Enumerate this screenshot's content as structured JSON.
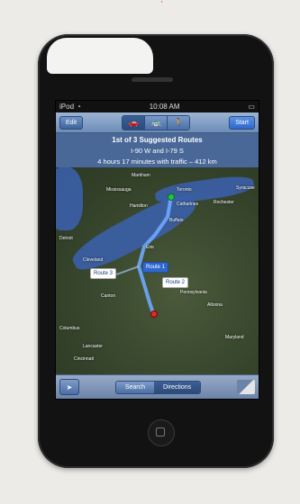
{
  "status": {
    "carrier": "iPod",
    "time": "10:08 AM"
  },
  "nav": {
    "edit": "Edit",
    "start": "Start",
    "modes": [
      {
        "name": "car-icon",
        "glyph": "🚗"
      },
      {
        "name": "bus-icon",
        "glyph": "🚌"
      },
      {
        "name": "walk-icon",
        "glyph": "🚶"
      }
    ]
  },
  "summary": {
    "title": "1st of 3 Suggested Routes",
    "roads": "I-90 W and I-79 S",
    "duration": "4 hours 17 minutes with traffic – 412 km"
  },
  "map": {
    "places": [
      "Markham",
      "Mississauga",
      "Hamilton",
      "Toronto",
      "Catharines",
      "Rochester",
      "Buffalo",
      "Detroit",
      "Cleveland",
      "Pennsylvania",
      "Altoona",
      "Columbus",
      "Maryland",
      "Canton",
      "Erie",
      "Syracuse",
      "Lancaster",
      "Cincinnati"
    ],
    "routes": [
      "Route 1",
      "Route 2",
      "Route 3"
    ]
  },
  "bottom": {
    "search": "Search",
    "directions": "Directions"
  }
}
